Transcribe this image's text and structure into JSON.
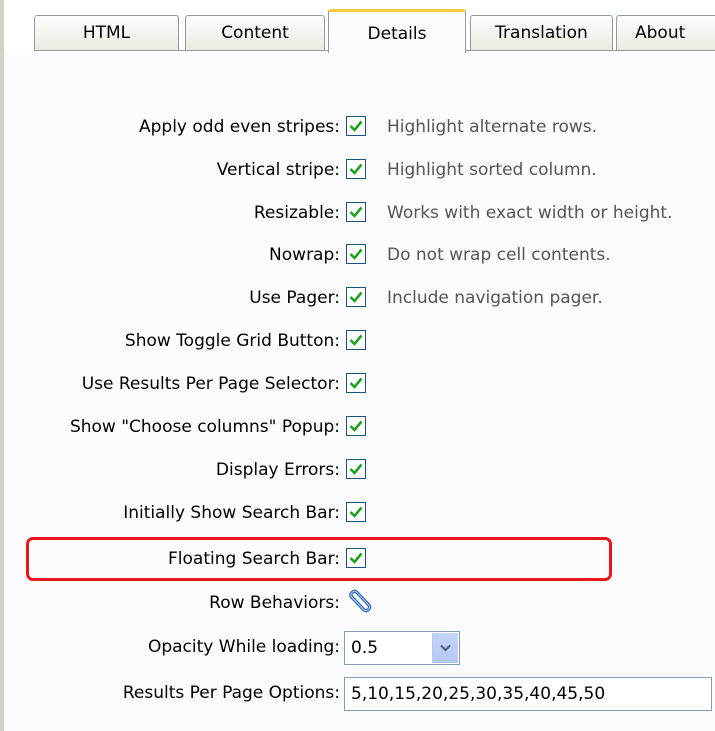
{
  "tabs": [
    {
      "label": "HTML",
      "active": false
    },
    {
      "label": "Content",
      "active": false
    },
    {
      "label": "Details",
      "active": true
    },
    {
      "label": "Translation",
      "active": false
    },
    {
      "label": "About",
      "active": false
    }
  ],
  "settings": [
    {
      "label": "Apply odd even stripes:",
      "checked": true,
      "description": "Highlight alternate rows."
    },
    {
      "label": "Vertical stripe:",
      "checked": true,
      "description": "Highlight sorted column."
    },
    {
      "label": "Resizable:",
      "checked": true,
      "description": "Works with exact width or height."
    },
    {
      "label": "Nowrap:",
      "checked": true,
      "description": "Do not wrap cell contents."
    },
    {
      "label": "Use Pager:",
      "checked": true,
      "description": "Include navigation pager."
    },
    {
      "label": "Show Toggle Grid Button:",
      "checked": true,
      "description": ""
    },
    {
      "label": "Use Results Per Page Selector:",
      "checked": true,
      "description": ""
    },
    {
      "label": "Show \"Choose columns\" Popup:",
      "checked": true,
      "description": ""
    },
    {
      "label": "Display Errors:",
      "checked": true,
      "description": ""
    },
    {
      "label": "Initially Show Search Bar:",
      "checked": true,
      "description": ""
    },
    {
      "label": "Floating Search Bar:",
      "checked": true,
      "description": "",
      "highlighted": true
    }
  ],
  "row_behaviors": {
    "label": "Row Behaviors:",
    "icon": "paperclip-icon"
  },
  "opacity": {
    "label": "Opacity While loading:",
    "value": "0.5"
  },
  "results_per_page": {
    "label": "Results Per Page Options:",
    "value": "5,10,15,20,25,30,35,40,45,50"
  },
  "colors": {
    "highlight_border": "#e8161e",
    "active_tab_accent": "#ffc83c",
    "checkbox_border": "#1c5180",
    "check_mark": "#21a121"
  }
}
